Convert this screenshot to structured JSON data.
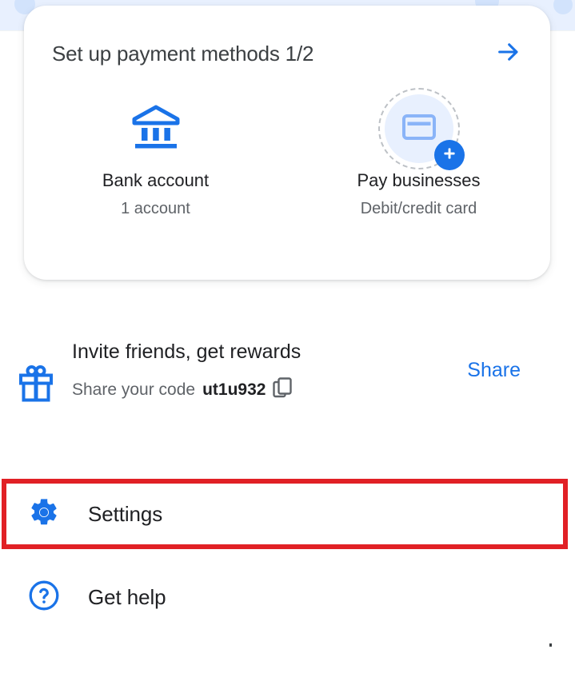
{
  "payment_card": {
    "title": "Set up payment methods 1/2",
    "next_arrow_icon": "arrow-right-icon",
    "tiles": [
      {
        "icon": "bank-icon",
        "label": "Bank account",
        "sub": "1 account"
      },
      {
        "icon": "credit-card-icon",
        "badge_icon": "plus-icon",
        "label": "Pay businesses",
        "sub": "Debit/credit card"
      }
    ]
  },
  "invite": {
    "icon": "gift-icon",
    "title": "Invite friends, get rewards",
    "share_prefix": "Share your code",
    "code": "ut1u932",
    "copy_icon": "copy-icon",
    "share_label": "Share"
  },
  "menu": [
    {
      "id": "settings",
      "icon": "gear-icon",
      "label": "Settings"
    },
    {
      "id": "gethelp",
      "icon": "help-circle-icon",
      "label": "Get help"
    }
  ],
  "annotation": {
    "target": "settings",
    "color": "#e12025"
  },
  "colors": {
    "accent_blue": "#1a73e8",
    "light_blue_bg": "#e8f0fe",
    "card_glyph_blue": "#8ab4f8",
    "text_primary": "#202124",
    "text_secondary": "#5f6368",
    "annotation_red": "#e12025"
  }
}
